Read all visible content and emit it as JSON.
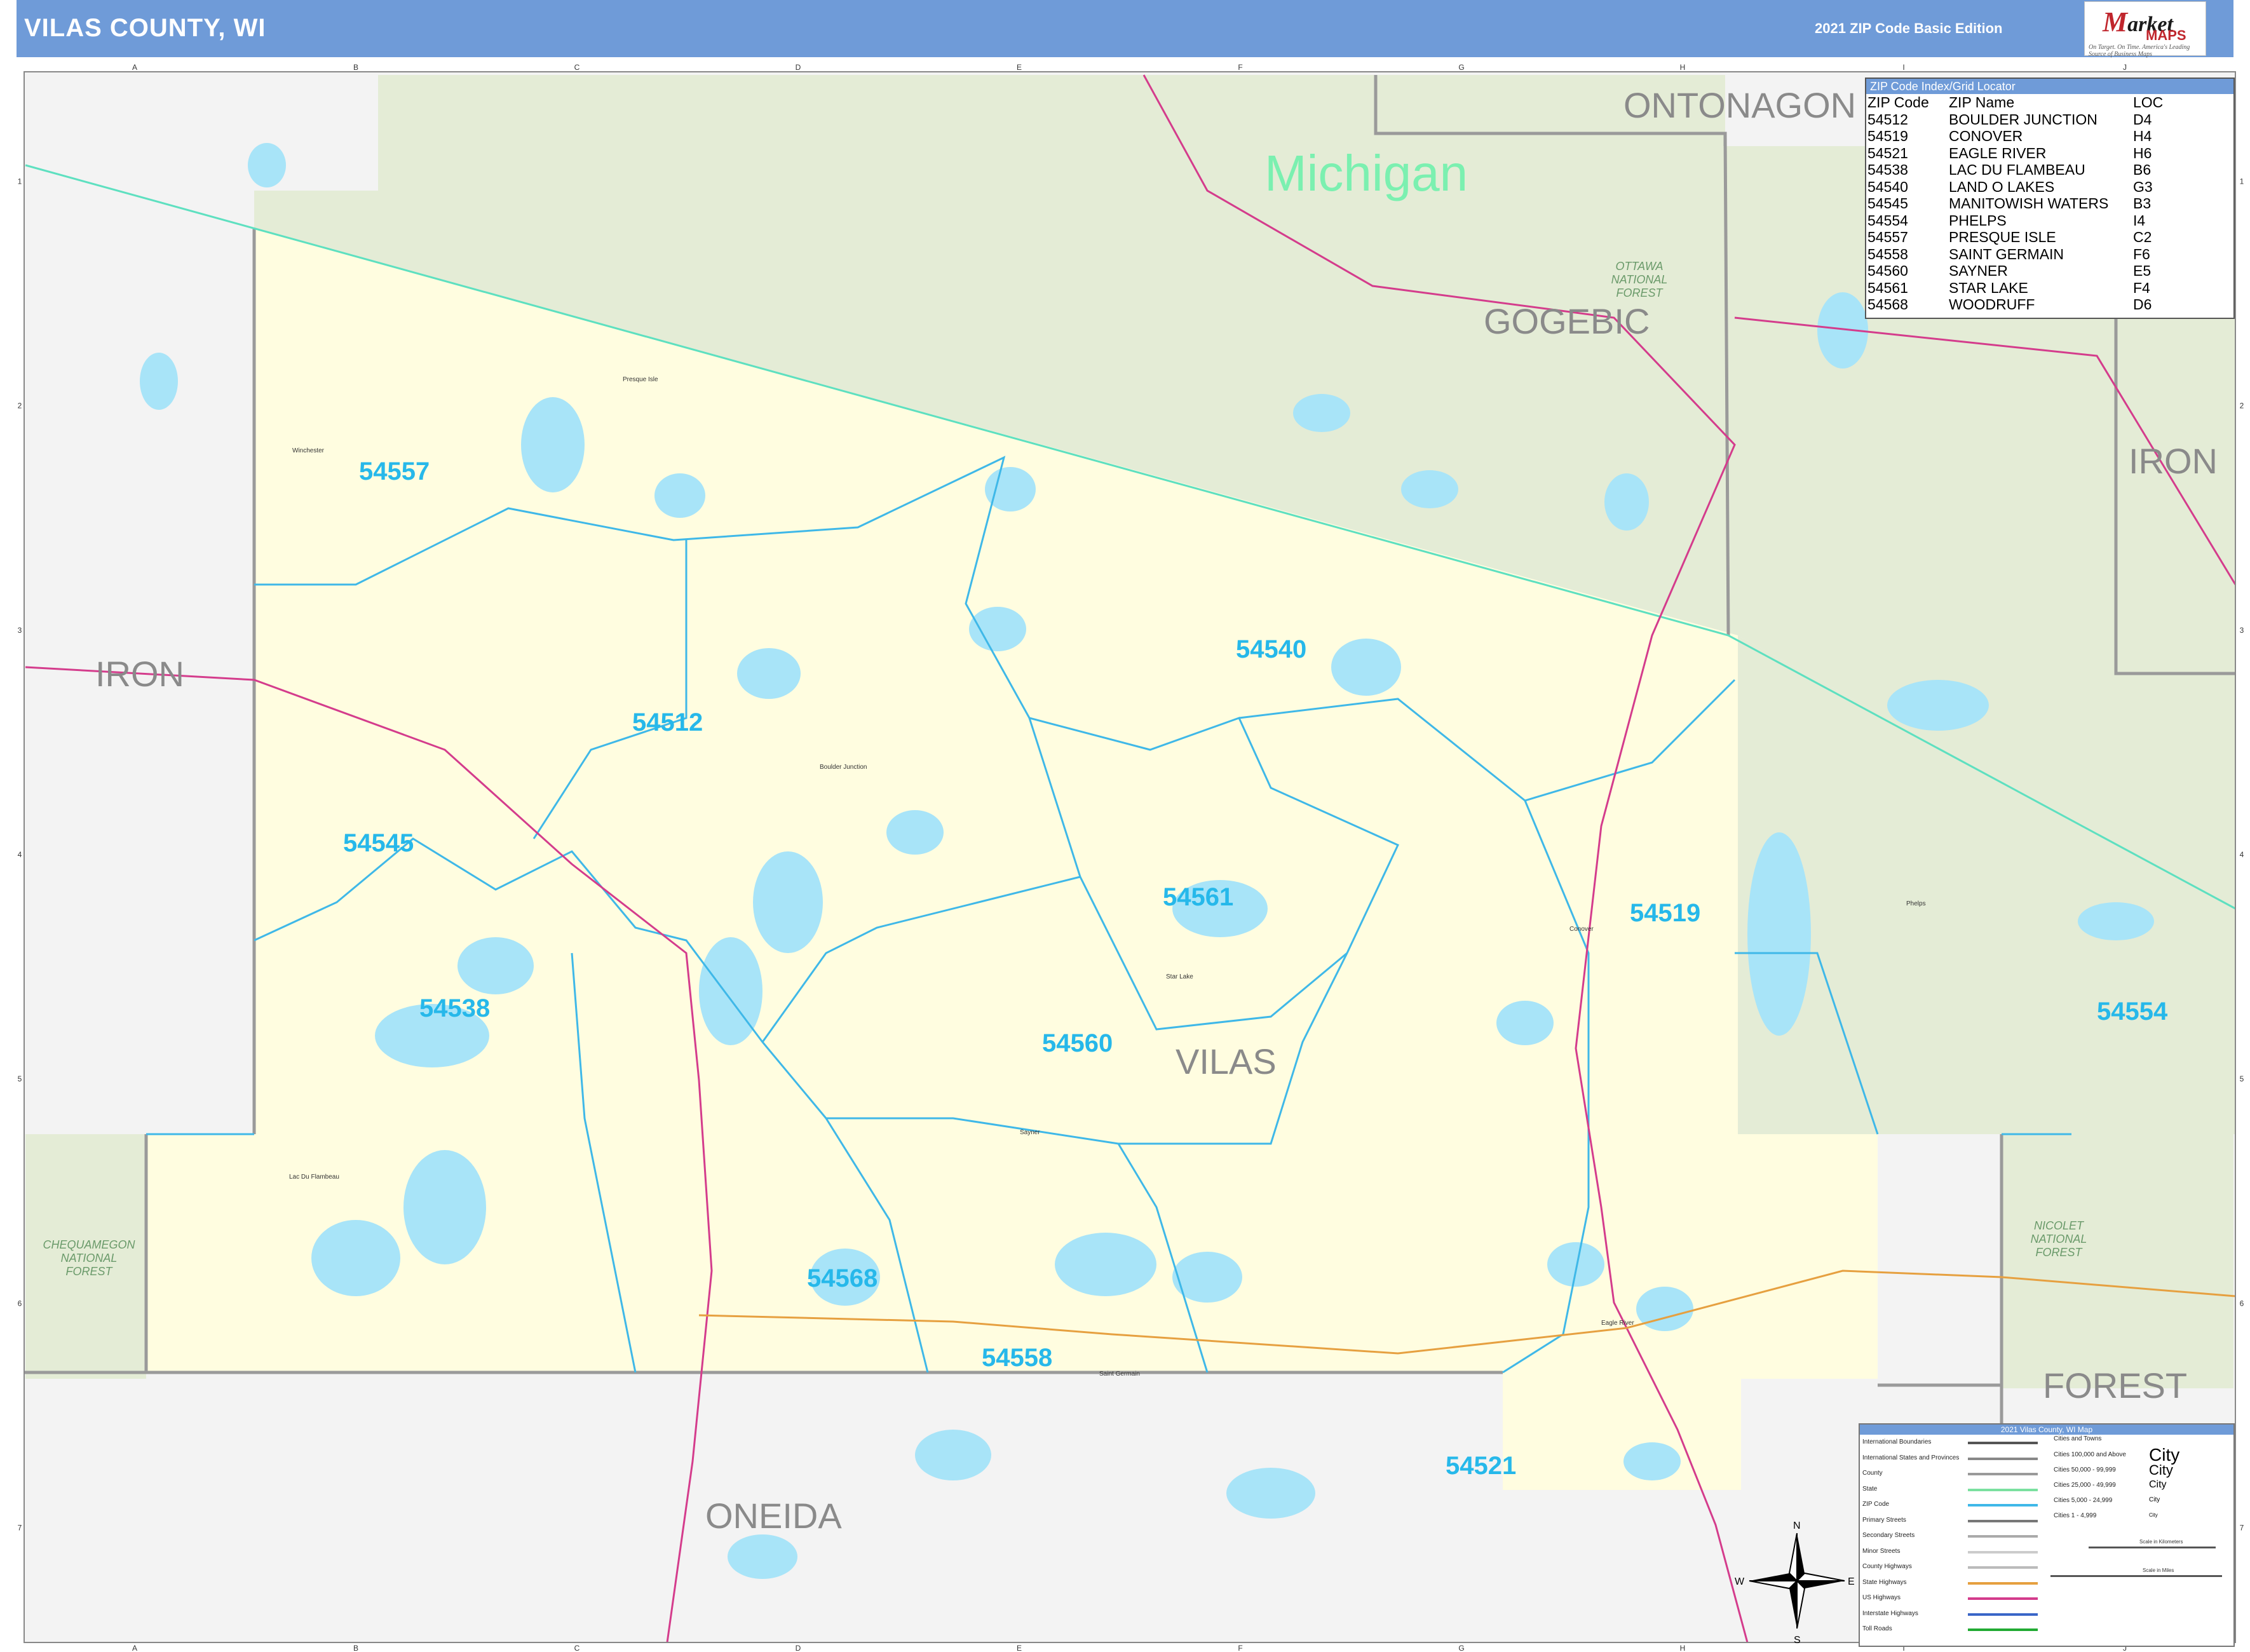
{
  "header": {
    "title": "VILAS COUNTY, WI",
    "edition": "2021 ZIP Code Basic Edition",
    "logo_word": "arket",
    "logo_m": "M",
    "logo_maps": "MAPS",
    "logo_tagline": "On Target. On Time. America's Leading Source of Business Maps"
  },
  "grid": {
    "columns": [
      "A",
      "B",
      "C",
      "D",
      "E",
      "F",
      "G",
      "H",
      "I",
      "J"
    ],
    "rows": [
      "1",
      "2",
      "3",
      "4",
      "5",
      "6",
      "7"
    ]
  },
  "map_labels": {
    "state": "Michigan",
    "counties": [
      {
        "id": "ontonagon",
        "text": "ONTONAGON"
      },
      {
        "id": "gogebic",
        "text": "GOGEBIC"
      },
      {
        "id": "iron-mi",
        "text": "IRON"
      },
      {
        "id": "iron-wi",
        "text": "IRON"
      },
      {
        "id": "vilas",
        "text": "VILAS"
      },
      {
        "id": "oneida",
        "text": "ONEIDA"
      },
      {
        "id": "forest",
        "text": "FOREST"
      }
    ],
    "forests": [
      {
        "id": "ottawa",
        "lines": [
          "OTTAWA",
          "NATIONAL",
          "FOREST"
        ]
      },
      {
        "id": "chequamegon",
        "lines": [
          "CHEQUAMEGON",
          "NATIONAL",
          "FOREST"
        ]
      },
      {
        "id": "nicolet",
        "lines": [
          "NICOLET",
          "NATIONAL",
          "FOREST"
        ]
      }
    ],
    "zips": [
      {
        "id": "54557",
        "text": "54557"
      },
      {
        "id": "54540",
        "text": "54540"
      },
      {
        "id": "54512",
        "text": "54512"
      },
      {
        "id": "54545",
        "text": "54545"
      },
      {
        "id": "54561",
        "text": "54561"
      },
      {
        "id": "54519",
        "text": "54519"
      },
      {
        "id": "54538",
        "text": "54538"
      },
      {
        "id": "54560",
        "text": "54560"
      },
      {
        "id": "54554",
        "text": "54554"
      },
      {
        "id": "54568",
        "text": "54568"
      },
      {
        "id": "54558",
        "text": "54558"
      },
      {
        "id": "54521",
        "text": "54521"
      }
    ],
    "towns": [
      {
        "id": "presque-isle",
        "text": "Presque Isle"
      },
      {
        "id": "winchester",
        "text": "Winchester"
      },
      {
        "id": "boulder-junction",
        "text": "Boulder Junction"
      },
      {
        "id": "star-lake",
        "text": "Star Lake"
      },
      {
        "id": "sayner",
        "text": "Sayner"
      },
      {
        "id": "lac-du-flambeau",
        "text": "Lac Du Flambeau"
      },
      {
        "id": "saint-germain",
        "text": "Saint Germain"
      },
      {
        "id": "conover",
        "text": "Conover"
      },
      {
        "id": "eagle-river",
        "text": "Eagle River"
      },
      {
        "id": "phelps",
        "text": "Phelps"
      }
    ]
  },
  "zip_index": {
    "title": "ZIP Code Index/Grid Locator",
    "headers": [
      "ZIP Code",
      "ZIP Name",
      "LOC"
    ],
    "rows": [
      [
        "54512",
        "BOULDER JUNCTION",
        "D4"
      ],
      [
        "54519",
        "CONOVER",
        "H4"
      ],
      [
        "54521",
        "EAGLE RIVER",
        "H6"
      ],
      [
        "54538",
        "LAC DU FLAMBEAU",
        "B6"
      ],
      [
        "54540",
        "LAND O LAKES",
        "G3"
      ],
      [
        "54545",
        "MANITOWISH WATERS",
        "B3"
      ],
      [
        "54554",
        "PHELPS",
        "I4"
      ],
      [
        "54557",
        "PRESQUE ISLE",
        "C2"
      ],
      [
        "54558",
        "SAINT GERMAIN",
        "F6"
      ],
      [
        "54560",
        "SAYNER",
        "E5"
      ],
      [
        "54561",
        "STAR LAKE",
        "F4"
      ],
      [
        "54568",
        "WOODRUFF",
        "D6"
      ]
    ]
  },
  "legend": {
    "title": "2021 Vilas County, WI Map",
    "items": [
      {
        "label": "International Boundaries",
        "color": "#555555"
      },
      {
        "label": "International States and Provinces",
        "color": "#888888"
      },
      {
        "label": "County",
        "color": "#9a9a9a"
      },
      {
        "label": "State",
        "color": "#7be0a0"
      },
      {
        "label": "ZIP Code",
        "color": "#3fb8e8"
      },
      {
        "label": "Primary Streets",
        "color": "#777777"
      },
      {
        "label": "Secondary Streets",
        "color": "#aaaaaa"
      },
      {
        "label": "Minor Streets",
        "color": "#cccccc"
      },
      {
        "label": "County Highways",
        "color": "#bbbbbb"
      },
      {
        "label": "State Highways",
        "color": "#e6a040"
      },
      {
        "label": "US Highways",
        "color": "#d43c8c"
      },
      {
        "label": "Interstate Highways",
        "color": "#3a66c8"
      },
      {
        "label": "Toll Roads",
        "color": "#22aa33"
      }
    ],
    "cities_title": "Cities and Towns",
    "cities": [
      {
        "label": "Cities 100,000 and Above",
        "sample": "City"
      },
      {
        "label": "Cities 50,000 - 99,999",
        "sample": "City"
      },
      {
        "label": "Cities 25,000 - 49,999",
        "sample": "City"
      },
      {
        "label": "Cities 5,000 - 24,999",
        "sample": "City"
      },
      {
        "label": "Cities 1 - 4,999",
        "sample": "City"
      }
    ],
    "scale_km": "Scale in Kilometers",
    "scale_mi": "Scale in Miles"
  },
  "compass": {
    "n": "N",
    "s": "S",
    "e": "E",
    "w": "W"
  },
  "colors": {
    "header": "#6f9bd8",
    "county_fill": "#fffde0",
    "forest_fill": "#e4ecd6",
    "outside_fill": "#f3f3f3",
    "water": "#a8e4f8",
    "zip_line": "#3fb8e8",
    "zip_label": "#26b8ea",
    "state_line": "#5ee0c0",
    "us_highway": "#d43c8c"
  }
}
